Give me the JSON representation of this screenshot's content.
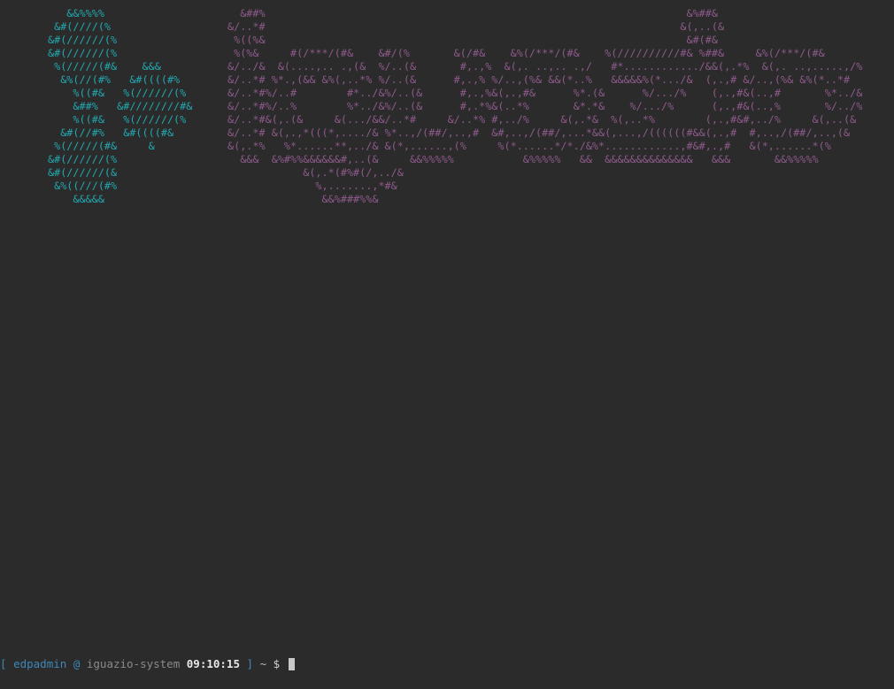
{
  "terminal": {
    "colors": {
      "background": "#2b2b2b",
      "logo": "#23a8b0",
      "wordmark": "#8e5a8c",
      "prompt_accent": "#3d88b8",
      "hostname": "#8a8a8a",
      "time": "#e8e8e8"
    },
    "logo_art": "   &&%%%%\n &#(////(%\n&#(//////(%\n&#(//////(%\n %(/////(#&    &&&\n  &%(//(#%   &#((((#%\n    %((#&   %(//////(%\n    &##%   &#////////#&\n    %((#&   %(//////(%\n  &#(//#%   &#((((#&\n %(/////(#&     &\n&#(//////(%\n&#(//////(&\n &%((///(#%\n    &&&&&",
    "wordmark_art": "  &##%                                                                   &%##&\n&/..*#                                                                  &(,..(&\n %((%&                                                                   &#(#&\n %(%&     #(/***/(#&    &#/(%       &(/#&    &%(/***/(#&    %(//////////#& %##&     &%(/***/(#&\n&/../&  &(....,.. .,(&  %/..(&       #,.,%  &(,. ..,.. .,/   #*............/&&(,.*%  &(,. ..,.....,/%\n&/..*# %*.,(&& &%(,..*% %/..(&      #,.,% %/..,(%& &&(*..%   &&&&&%(*.../&  (,.,# &/..,(%& &%(*..*#\n&/..*#%/..#        #*../&%/..(&      #,.,%&(,.,#&      %*.(&      %/.../%    (,.,#&(..,#       %*../&\n&/..*#%/..%        %*../&%/..(&      #,.*%&(..*%       &*.*&    %/.../%      (,.,#&(..,%       %/../%\n&/..*#&(,.(&     &(.../&&/..*#     &/..*% #,../%     &(,.*&  %(,..*%        (,.,#&#,../%     &(,..(&\n&/..*# &(,.,*(((*,..../& %*..,/(##/,..,#  &#,..,/(##/,...*&&(,...,/((((((#&&(,.,#  #,..,/(##/,..,(&\n&(,.*%   %*......**,../& &(*,......,(%     %(*......*/*./&%*............,#&#,.,#   &(*,......*(%\n  &&&  &%#%%&&&&&&#,..(&     &&%%%%%           &%%%%%   &&  &&&&&&&&&&&&&&   &&&       &&%%%%%\n            &(,.*(#%#(/,../&\n              %,.......,*#&\n               &&%###%%&",
    "prompt": {
      "bracket_open": "[",
      "user": "edpadmin",
      "at": "@",
      "host": "iguazio-system",
      "time": "09:10:15",
      "bracket_close": "]",
      "cwd": "~",
      "symbol": "$"
    }
  }
}
